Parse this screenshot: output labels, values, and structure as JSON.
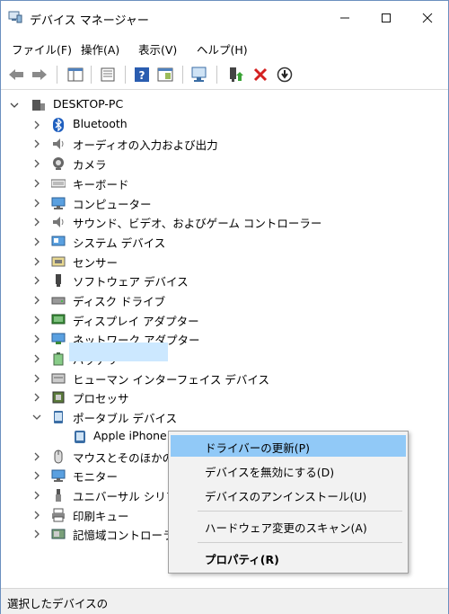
{
  "window": {
    "title": "デバイス マネージャー"
  },
  "menubar": {
    "items": [
      "ファイル(F)",
      "操作(A)",
      "表示(V)",
      "ヘルプ(H)"
    ]
  },
  "toolbar": {
    "icons": [
      "back-icon",
      "forward-icon",
      "properties-pane-icon",
      "device-properties-icon",
      "help-icon",
      "view-icon",
      "scan-hardware-icon",
      "update-driver-icon",
      "uninstall-icon",
      "disable-icon"
    ]
  },
  "tree": {
    "root": "DESKTOP-PC",
    "items": [
      "Bluetooth",
      "オーディオの入力および出力",
      "カメラ",
      "キーボード",
      "コンピューター",
      "サウンド、ビデオ、およびゲーム コントローラー",
      "システム デバイス",
      "センサー",
      "ソフトウェア デバイス",
      "ディスク ドライブ",
      "ディスプレイ アダプター",
      "ネットワーク アダプター",
      "バッテリ",
      "ヒューマン インターフェイス デバイス",
      "プロセッサ",
      "ポータブル デバイス",
      "Apple iPhone",
      "マウスとそのほかのポ",
      "モニター",
      "ユニバーサル シリアル",
      "印刷キュー",
      "記憶域コントローラー"
    ]
  },
  "context_menu": {
    "items": [
      "ドライバーの更新(P)",
      "デバイスを無効にする(D)",
      "デバイスのアンインストール(U)",
      "ハードウェア変更のスキャン(A)",
      "プロパティ(R)"
    ]
  },
  "statusbar": {
    "text": "選択したデバイスの"
  }
}
